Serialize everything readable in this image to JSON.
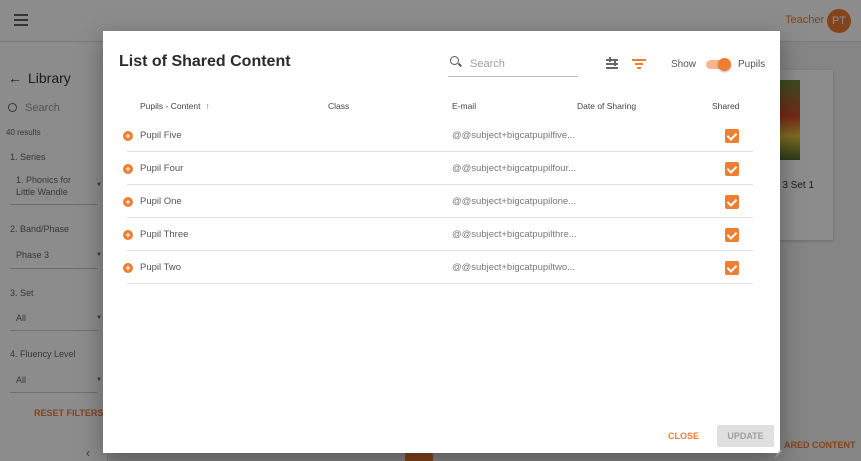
{
  "app": {
    "user_name": "Teacher",
    "avatar_initials": "PT",
    "sidebar": {
      "title": "Library",
      "search_placeholder": "Search",
      "results": "40 results",
      "filters": [
        {
          "label": "1. Series",
          "value": "1. Phonics for Little Wandle"
        },
        {
          "label": "2. Band/Phase",
          "value": "Phase 3"
        },
        {
          "label": "3. Set",
          "value": "All"
        },
        {
          "label": "4. Fluency Level",
          "value": "All"
        }
      ],
      "reset_label": "RESET FILTERS",
      "back_chevron": "‹"
    },
    "card_title": "e 3 Set 1",
    "bottom_action": "ARED CONTENT"
  },
  "dialog": {
    "title": "List of Shared Content",
    "search_placeholder": "Search",
    "show_label": "Show",
    "toggle_on": true,
    "toggle_label": "Pupils",
    "columns": {
      "pupil": "Pupils - Content",
      "class": "Class",
      "email": "E-mail",
      "date": "Date of Sharing",
      "shared": "Shared"
    },
    "sort_arrow": "↑",
    "rows": [
      {
        "pupil": "Pupil Five",
        "class": "",
        "email": "@@subject+bigcatpupilfive...",
        "date": "",
        "shared": true
      },
      {
        "pupil": "Pupil Four",
        "class": "",
        "email": "@@subject+bigcatpupilfour...",
        "date": "",
        "shared": true
      },
      {
        "pupil": "Pupil One",
        "class": "",
        "email": "@@subject+bigcatpupilone...",
        "date": "",
        "shared": true
      },
      {
        "pupil": "Pupil Three",
        "class": "",
        "email": "@@subject+bigcatpupilthre...",
        "date": "",
        "shared": true
      },
      {
        "pupil": "Pupil Two",
        "class": "",
        "email": "@@subject+bigcatpupiltwo...",
        "date": "",
        "shared": true
      }
    ],
    "close_label": "CLOSE",
    "update_label": "UPDATE"
  },
  "colors": {
    "accent": "#ef7d32",
    "overlay": "rgba(0,0,0,0.45)",
    "disabled": "#e0e0e0"
  }
}
